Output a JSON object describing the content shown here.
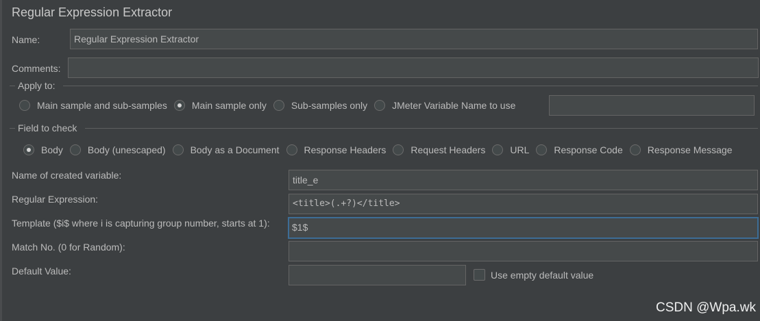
{
  "panel": {
    "title": "Regular Expression Extractor"
  },
  "name": {
    "label": "Name:",
    "value": "Regular Expression Extractor"
  },
  "comments": {
    "label": "Comments:",
    "value": ""
  },
  "apply_to": {
    "legend": "Apply to:",
    "options": [
      {
        "label": "Main sample and sub-samples",
        "selected": false
      },
      {
        "label": "Main sample only",
        "selected": true
      },
      {
        "label": "Sub-samples only",
        "selected": false
      },
      {
        "label": "JMeter Variable Name to use",
        "selected": false
      }
    ],
    "variable_value": ""
  },
  "field_to_check": {
    "legend": "Field to check",
    "options": [
      {
        "label": "Body",
        "selected": true
      },
      {
        "label": "Body (unescaped)",
        "selected": false
      },
      {
        "label": "Body as a Document",
        "selected": false
      },
      {
        "label": "Response Headers",
        "selected": false
      },
      {
        "label": "Request Headers",
        "selected": false
      },
      {
        "label": "URL",
        "selected": false
      },
      {
        "label": "Response Code",
        "selected": false
      },
      {
        "label": "Response Message",
        "selected": false
      }
    ]
  },
  "form": {
    "variable_name": {
      "label": "Name of created variable:",
      "value": "title_e"
    },
    "regex": {
      "label": "Regular Expression:",
      "value": "<title>(.+?)</title>"
    },
    "template": {
      "label": "Template ($i$ where i is capturing group number, starts at 1):",
      "value": "$1$"
    },
    "match_no": {
      "label": "Match No. (0 for Random):",
      "value": ""
    },
    "default_value": {
      "label": "Default Value:",
      "value": ""
    },
    "use_empty_default": {
      "label": "Use empty default value",
      "checked": false
    }
  },
  "watermark": "CSDN @Wpa.wk"
}
